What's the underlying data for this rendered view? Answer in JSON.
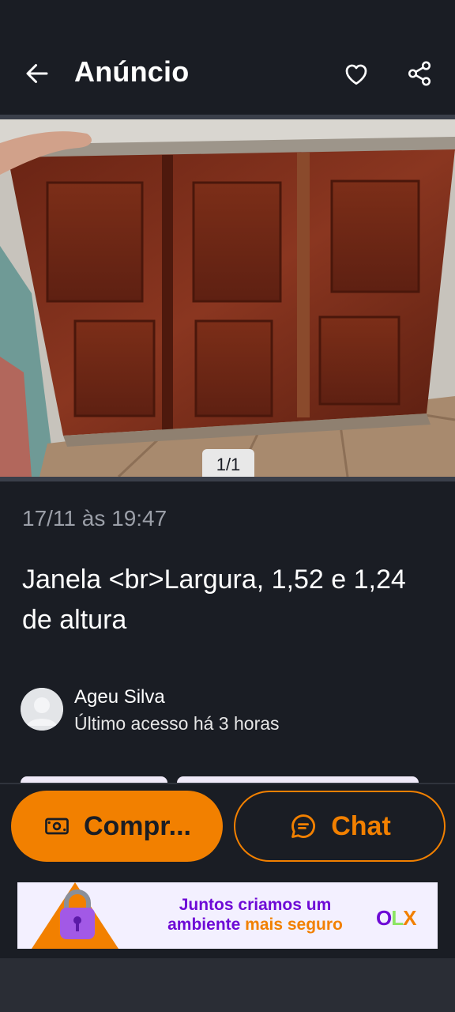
{
  "appbar": {
    "title": "Anúncio",
    "back_icon": "arrow-left-icon",
    "favorite_icon": "heart-outline-icon",
    "share_icon": "share-icon"
  },
  "gallery": {
    "counter": "1/1"
  },
  "ad": {
    "date": "17/11 às 19:47",
    "title": "Janela <br>Largura, 1,52 e 1,24 de altura"
  },
  "seller": {
    "name": "Ageu Silva",
    "last_access": "Último acesso há 3 horas"
  },
  "actions": {
    "buy_label": "Compr...",
    "chat_label": "Chat"
  },
  "banner": {
    "line1": "Juntos criamos um",
    "line2_a": "ambiente ",
    "line2_b": "mais seguro",
    "logo_o": "O",
    "logo_l": "L",
    "logo_x": "X"
  },
  "colors": {
    "background": "#1a1d24",
    "accent": "#f28000",
    "brand_purple": "#6e0ad6"
  }
}
